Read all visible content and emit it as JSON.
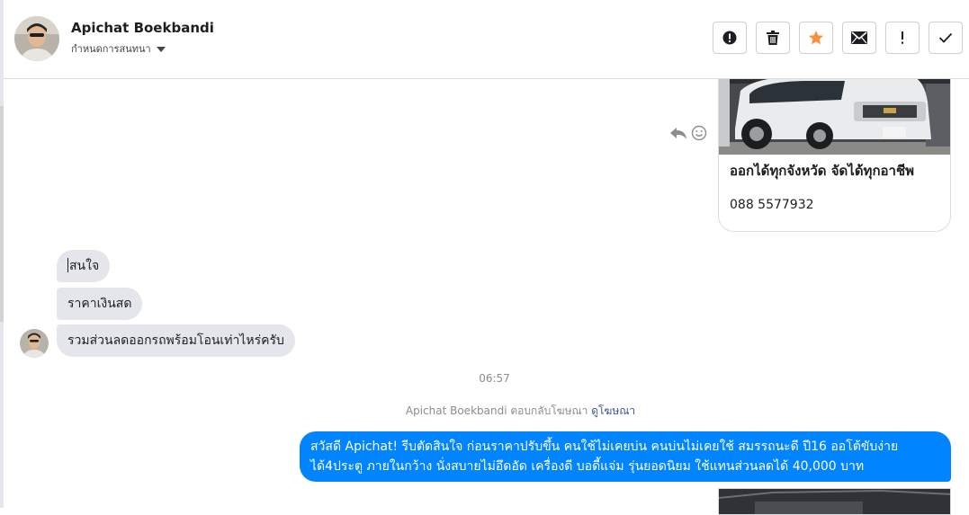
{
  "header": {
    "contact_name": "Apichat Boekbandi",
    "assign_label": "กำหนดการสนทนา",
    "avatar_icon": "user-avatar",
    "toolbar": [
      {
        "name": "mark-spam-button",
        "icon": "alert-circle-icon"
      },
      {
        "name": "delete-button",
        "icon": "trash-icon"
      },
      {
        "name": "star-button",
        "icon": "star-icon",
        "color": "#f7923a"
      },
      {
        "name": "mark-unread-button",
        "icon": "envelope-icon"
      },
      {
        "name": "follow-up-button",
        "icon": "exclamation-icon"
      },
      {
        "name": "mark-done-button",
        "icon": "checkmark-icon"
      }
    ]
  },
  "conversation": {
    "ad_card": {
      "title": "ออกได้ทุกจังหวัด จัดได้ทุกอาชีพ",
      "phone": "088 5577932",
      "image_icon": "white-pickup-truck-photo"
    },
    "incoming_messages": [
      {
        "text": "สนใจ"
      },
      {
        "text": "ราคาเงินสด"
      },
      {
        "text": "รวมส่วนลดออกรถพร้อมโอนเท่าไหร่ครับ"
      }
    ],
    "timestamp": "06:57",
    "reply_note": {
      "text": "Apichat Boekbandi ตอบกลับโฆษณา",
      "link": "ดูโฆษณา"
    },
    "outgoing_message": {
      "line1": "สวัสดี Apichat! รีบตัดสินใจ ก่อนราคาปรับขึ้น คนใช้ไม่เคยบ่น คนบ่นไม่เคยใช้ สมรรถนะดี ปี16 ออโต้ขับง่าย",
      "line2": "ได้4ประตู ภายในกว้าง นั่งสบายไม่อึดอัด เครื่องดี บอดี้แจ่ม รุ่นยอดนิยม  ใช้แทนส่วนลดได้ 40,000 บาท"
    }
  },
  "colors": {
    "accent_blue": "#0084ff",
    "incoming_bubble": "#e4e6eb",
    "star": "#f7923a",
    "link": "#385898"
  }
}
